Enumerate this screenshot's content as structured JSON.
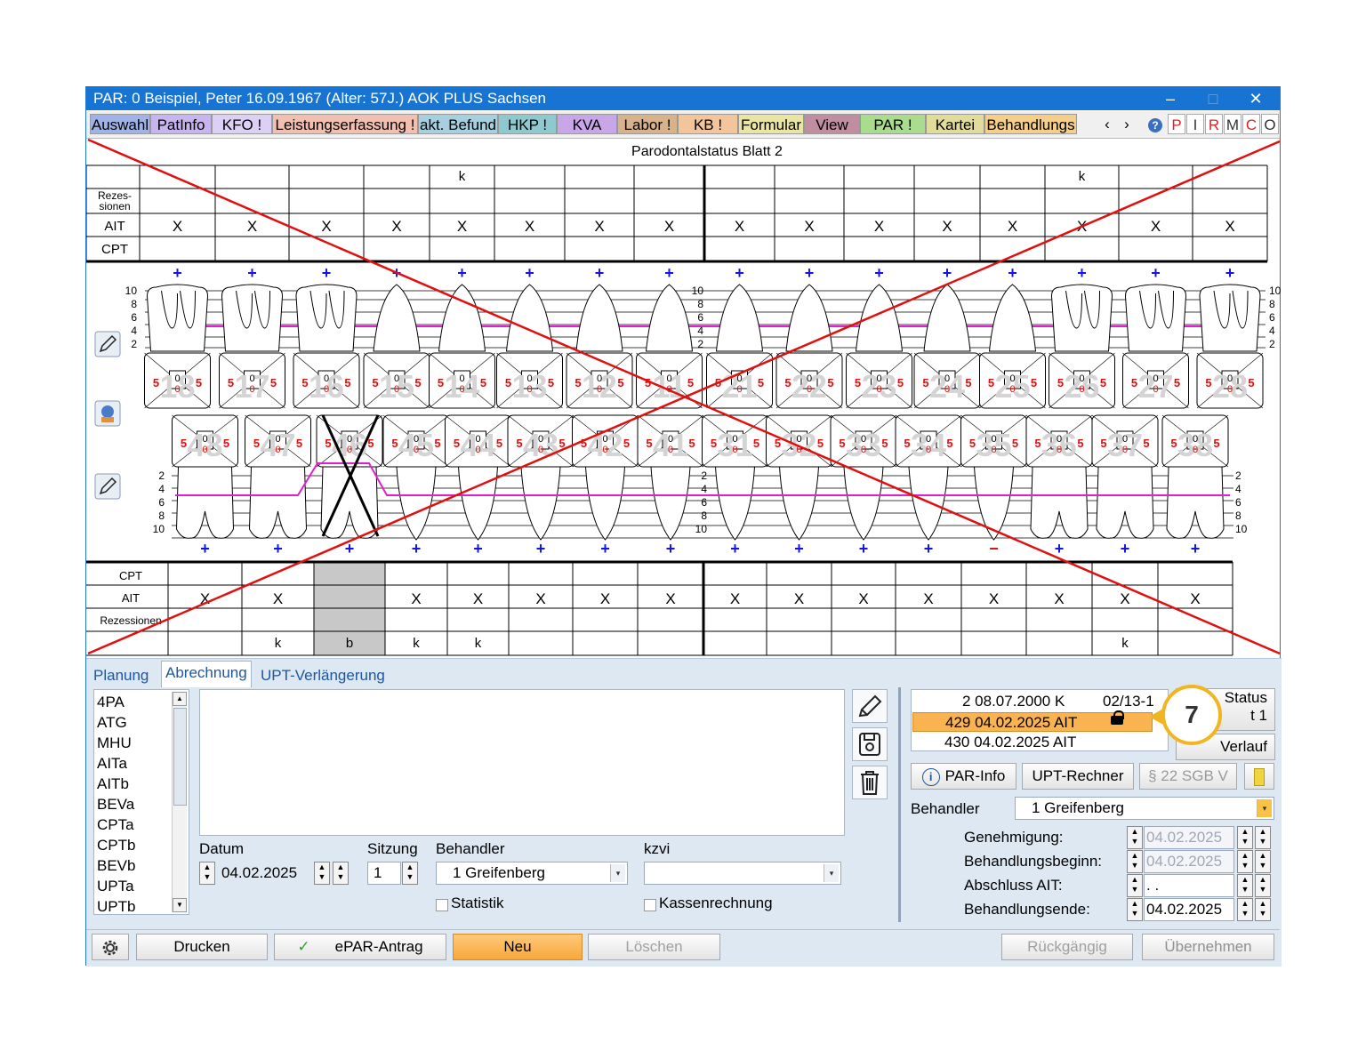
{
  "window": {
    "title": "PAR: 0  Beispiel, Peter  16.09.1967 (Alter: 57J.)  AOK PLUS Sachsen",
    "minimize_icon": "minimize-icon",
    "maximize_icon": "maximize-icon",
    "close_icon": "close-icon"
  },
  "tabs": [
    {
      "label": "Auswahl",
      "color": "#9fb3e6"
    },
    {
      "label": "PatInfo",
      "color": "#c8b4ef"
    },
    {
      "label": "KFO !",
      "color": "#ddd0f5"
    },
    {
      "label": "Leistungserfassung !",
      "color": "#f2c0b0"
    },
    {
      "label": "akt. Befund",
      "color": "#a6cfe0"
    },
    {
      "label": "HKP !",
      "color": "#8ec9cf"
    },
    {
      "label": "KVA",
      "color": "#c9a6e8"
    },
    {
      "label": "Labor !",
      "color": "#d7b28b"
    },
    {
      "label": "KB !",
      "color": "#f2c59b"
    },
    {
      "label": "Formular",
      "color": "#e8e6a2"
    },
    {
      "label": "View",
      "color": "#c08ea0"
    },
    {
      "label": "PAR !",
      "color": "#a9dc8c"
    },
    {
      "label": "Kartei",
      "color": "#e2dc9a"
    },
    {
      "label": "Behandlungs",
      "color": "#f5cf8a"
    }
  ],
  "tab_scroll": {
    "left": "‹",
    "right": "›"
  },
  "right_squares": [
    "P",
    "I",
    "R",
    "M",
    "C",
    "O"
  ],
  "help_icon": "help-icon",
  "chart": {
    "title": "Parodontalstatus Blatt 2",
    "upper_k": [
      {
        "col": 4,
        "text": "k"
      },
      {
        "col": 13,
        "text": "k"
      }
    ],
    "upper_row_labels": {
      "rez": "Rezes-\nsionen",
      "rez1": "Rezes-",
      "rez2": "sionen",
      "ait": "AIT",
      "cpt": "CPT"
    },
    "upper_ait_mark": "X",
    "lower_row_labels": {
      "cpt": "CPT",
      "ait": "AIT",
      "rez": "Rezessionen"
    },
    "lower_ait_mark": "X",
    "lower_bottom": [
      {
        "col": 2,
        "text": "k"
      },
      {
        "col": 3,
        "text": "b"
      },
      {
        "col": 4,
        "text": "k"
      },
      {
        "col": 5,
        "text": "k"
      },
      {
        "col": 15,
        "text": "k"
      }
    ],
    "scale_labels": [
      "10",
      "8",
      "6",
      "4",
      "2"
    ],
    "plus": "+",
    "minus": "−",
    "tooth_numbers_upper": [
      "18",
      "17",
      "16",
      "15",
      "14",
      "13",
      "12",
      "11",
      "21",
      "22",
      "23",
      "24",
      "25",
      "26",
      "27",
      "28"
    ],
    "tooth_numbers_lower": [
      "48",
      "47",
      "46",
      "45",
      "44",
      "43",
      "42",
      "41",
      "31",
      "32",
      "33",
      "34",
      "35",
      "36",
      "37",
      "38"
    ],
    "pocket_value": "5",
    "mid_value": "0",
    "side_icons": [
      "pencil-icon",
      "patient-icon",
      "pencil-icon"
    ]
  },
  "lower": {
    "tabs": [
      "Planung",
      "Abrechnung",
      "UPT-Verlängerung"
    ],
    "list_items": [
      "4PA",
      "ATG",
      "MHU",
      "AITa",
      "AITb",
      "BEVa",
      "CPTa",
      "CPTb",
      "BEVb",
      "UPTa",
      "UPTb"
    ],
    "datum_label": "Datum",
    "datum_value": "04.02.2025",
    "sitzung_label": "Sitzung",
    "sitzung_value": "1",
    "behandler_label": "Behandler",
    "behandler_value": "1 Greifenberg",
    "kzvi_label": "kzvi",
    "kzvi_value": "",
    "statistik_label": "Statistik",
    "kassenrechnung_label": "Kassenrechnung",
    "tool_icons": [
      "pencil-icon",
      "save-icon",
      "trash-icon"
    ],
    "records": [
      {
        "text": "2 08.07.2000  K",
        "right": "02/13-1"
      },
      {
        "text": "429 04.02.2025  AIT",
        "right": ""
      },
      {
        "text": "430 04.02.2025  AIT",
        "right": ""
      }
    ],
    "callout_number": "7",
    "status_label": "Status",
    "status_sub": "t 1",
    "verlauf_label": "Verlauf",
    "par_info_label": "PAR-Info",
    "upt_rechner_label": "UPT-Rechner",
    "sgb_label": "§ 22 SGB V",
    "behandler2_label": "Behandler",
    "behandler2_value": "1 Greifenberg",
    "dates": [
      {
        "label": "Genehmigung:",
        "value": "04.02.2025",
        "disabled": true
      },
      {
        "label": "Behandlungsbeginn:",
        "value": "04.02.2025",
        "disabled": true
      },
      {
        "label": "Abschluss AIT:",
        "value": " .  . ",
        "disabled": false
      },
      {
        "label": "Behandlungsende:",
        "value": "04.02.2025",
        "disabled": false
      }
    ]
  },
  "footer": {
    "settings_icon": "gear-icon",
    "drucken": "Drucken",
    "epar": "ePAR-Antrag",
    "neu": "Neu",
    "loeschen": "Löschen",
    "rueckgaengig": "Rückgängig",
    "uebernehmen": "Übernehmen"
  },
  "colors": {
    "title_bar": "#1874d2",
    "accent_orange": "#f9b451",
    "callout": "#f2b522",
    "cross_red": "#e01010",
    "line_magenta": "#e020d0"
  }
}
